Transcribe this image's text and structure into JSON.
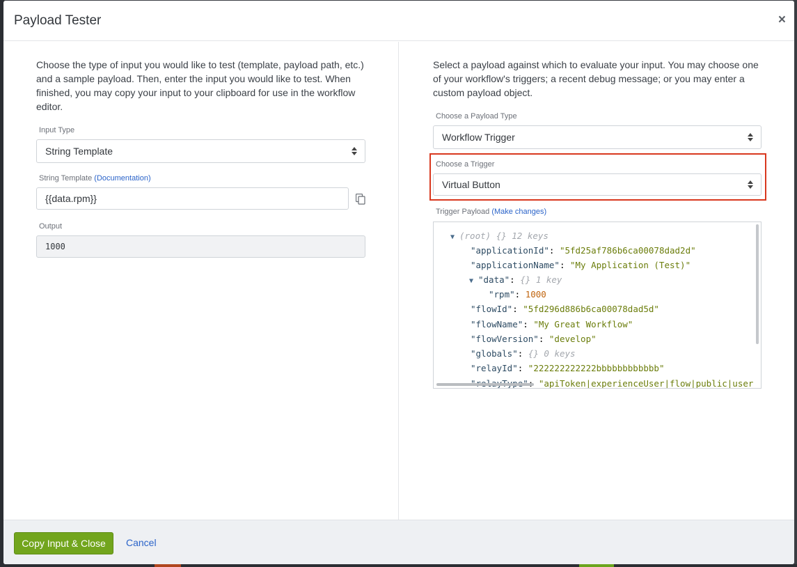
{
  "modal": {
    "title": "Payload Tester",
    "close_label": "×"
  },
  "left": {
    "intro": "Choose the type of input you would like to test (template, payload path, etc.) and a sample payload. Then, enter the input you would like to test. When finished, you may copy your input to your clipboard for use in the workflow editor.",
    "input_type_label": "Input Type",
    "input_type_value": "String Template",
    "string_template_label": "String Template",
    "documentation_link": "(Documentation)",
    "string_template_value": "{{data.rpm}}",
    "output_label": "Output",
    "output_value": "1000"
  },
  "right": {
    "intro": "Select a payload against which to evaluate your input. You may choose one of your workflow's triggers; a recent debug message; or you may enter a custom payload object.",
    "payload_type_label": "Choose a Payload Type",
    "payload_type_value": "Workflow Trigger",
    "trigger_label": "Choose a Trigger",
    "trigger_value": "Virtual Button",
    "trigger_payload_label": "Trigger Payload",
    "make_changes_link": "(Make changes)",
    "tree": {
      "root_label": "(root)",
      "root_meta": "{}",
      "root_count": "12 keys",
      "application_id_key": "\"applicationId\"",
      "application_id_value": "\"5fd25af786b6ca00078dad2d\"",
      "application_name_key": "\"applicationName\"",
      "application_name_value": "\"My Application (Test)\"",
      "data_key": "\"data\"",
      "data_meta": "{}",
      "data_count": "1 key",
      "rpm_key": "\"rpm\"",
      "rpm_value": "1000",
      "flow_id_key": "\"flowId\"",
      "flow_id_value": "\"5fd296d886b6ca00078dad5d\"",
      "flow_name_key": "\"flowName\"",
      "flow_name_value": "\"My Great Workflow\"",
      "flow_version_key": "\"flowVersion\"",
      "flow_version_value": "\"develop\"",
      "globals_key": "\"globals\"",
      "globals_meta": "{}",
      "globals_count": "0 keys",
      "relay_id_key": "\"relayId\"",
      "relay_id_value": "\"222222222222bbbbbbbbbbbb\"",
      "relay_type_key": "\"relayType\"",
      "relay_type_value": "\"apiToken|experienceUser|flow|public|user"
    }
  },
  "footer": {
    "copy_button": "Copy Input & Close",
    "cancel_button": "Cancel"
  },
  "colors": {
    "primary": "#72a51d",
    "link": "#2a63c9",
    "highlight": "#d9381e"
  }
}
